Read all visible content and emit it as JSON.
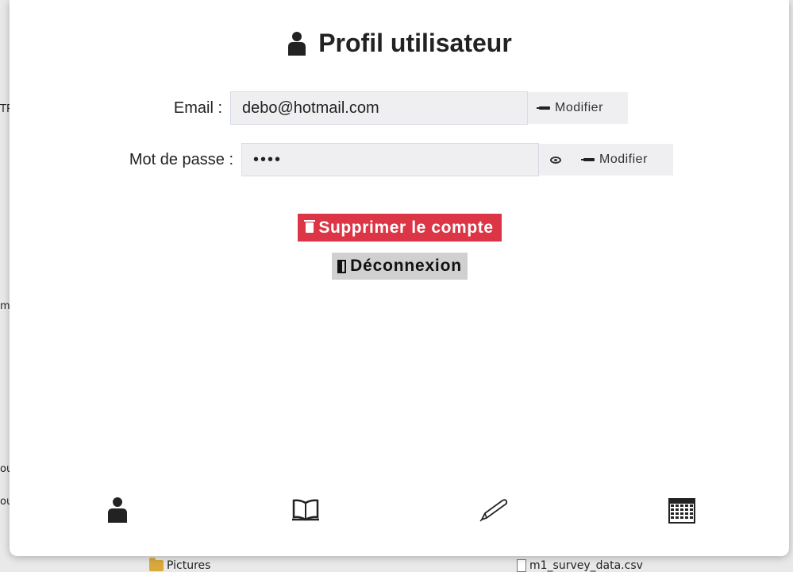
{
  "background": {
    "left_fragments": [
      "TR",
      "m",
      "ou",
      "ou"
    ],
    "bottom_items": [
      "Pictures",
      "m1_survey_data.csv"
    ]
  },
  "profile": {
    "title": "Profil utilisateur",
    "email_label": "Email :",
    "email_value": "debo@hotmail.com",
    "email_modify": "Modifier",
    "password_label": "Mot de passe :",
    "password_value": "••••",
    "password_modify": "Modifier",
    "delete_account": "Supprimer le compte",
    "logout": "Déconnexion"
  },
  "bottom_nav": [
    "person-icon",
    "book-icon",
    "pen-icon",
    "calendar-icon"
  ],
  "colors": {
    "danger": "#dc3545",
    "field_bg": "#efeff1",
    "logout_bg": "#d0d0d0"
  }
}
